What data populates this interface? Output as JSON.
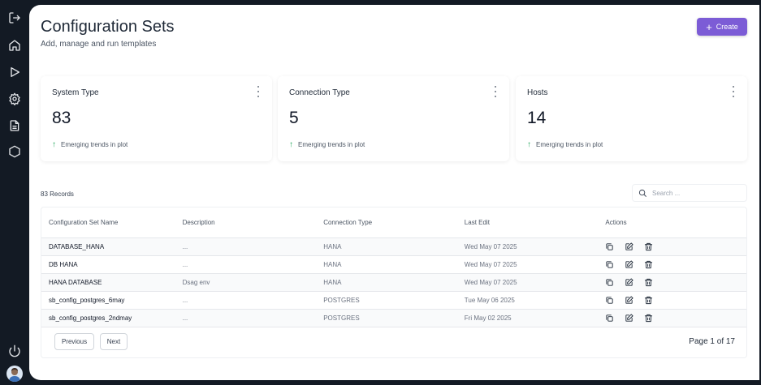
{
  "header": {
    "title": "Configuration Sets",
    "subtitle": "Add, manage and run templates",
    "create_label": "Create"
  },
  "sidebar": {
    "items": [
      {
        "icon": "logout-icon"
      },
      {
        "icon": "home-icon"
      },
      {
        "icon": "play-icon"
      },
      {
        "icon": "gear-icon"
      },
      {
        "icon": "document-icon"
      },
      {
        "icon": "hexagon-icon"
      }
    ],
    "bottom": [
      {
        "icon": "power-icon"
      },
      {
        "icon": "avatar"
      }
    ]
  },
  "cards": [
    {
      "title": "System Type",
      "value": "83",
      "trend": "Emerging trends in plot"
    },
    {
      "title": "Connection Type",
      "value": "5",
      "trend": "Emerging trends in plot"
    },
    {
      "title": "Hosts",
      "value": "14",
      "trend": "Emerging trends in plot"
    }
  ],
  "table": {
    "records_label": "83 Records",
    "search_placeholder": "Search ...",
    "columns": [
      "Configuration Set Name",
      "Description",
      "Connection Type",
      "Last Edit",
      "Actions"
    ],
    "rows": [
      {
        "name": "DATABASE_HANA",
        "description": "...",
        "connection": "HANA",
        "last_edit": "Wed May 07 2025"
      },
      {
        "name": "DB HANA",
        "description": "...",
        "connection": "HANA",
        "last_edit": "Wed May 07 2025"
      },
      {
        "name": "HANA DATABASE",
        "description": "Dsag env",
        "connection": "HANA",
        "last_edit": "Wed May 07 2025"
      },
      {
        "name": "sb_config_postgres_6may",
        "description": "...",
        "connection": "POSTGRES",
        "last_edit": "Tue May 06 2025"
      },
      {
        "name": "sb_config_postgres_2ndmay",
        "description": "...",
        "connection": "POSTGRES",
        "last_edit": "Fri May 02 2025"
      }
    ],
    "previous_label": "Previous",
    "next_label": "Next",
    "page_info": "Page 1 of 17"
  },
  "colors": {
    "accent": "#7c5cd6",
    "sidebar": "#131a24",
    "trend": "#22a55a"
  }
}
